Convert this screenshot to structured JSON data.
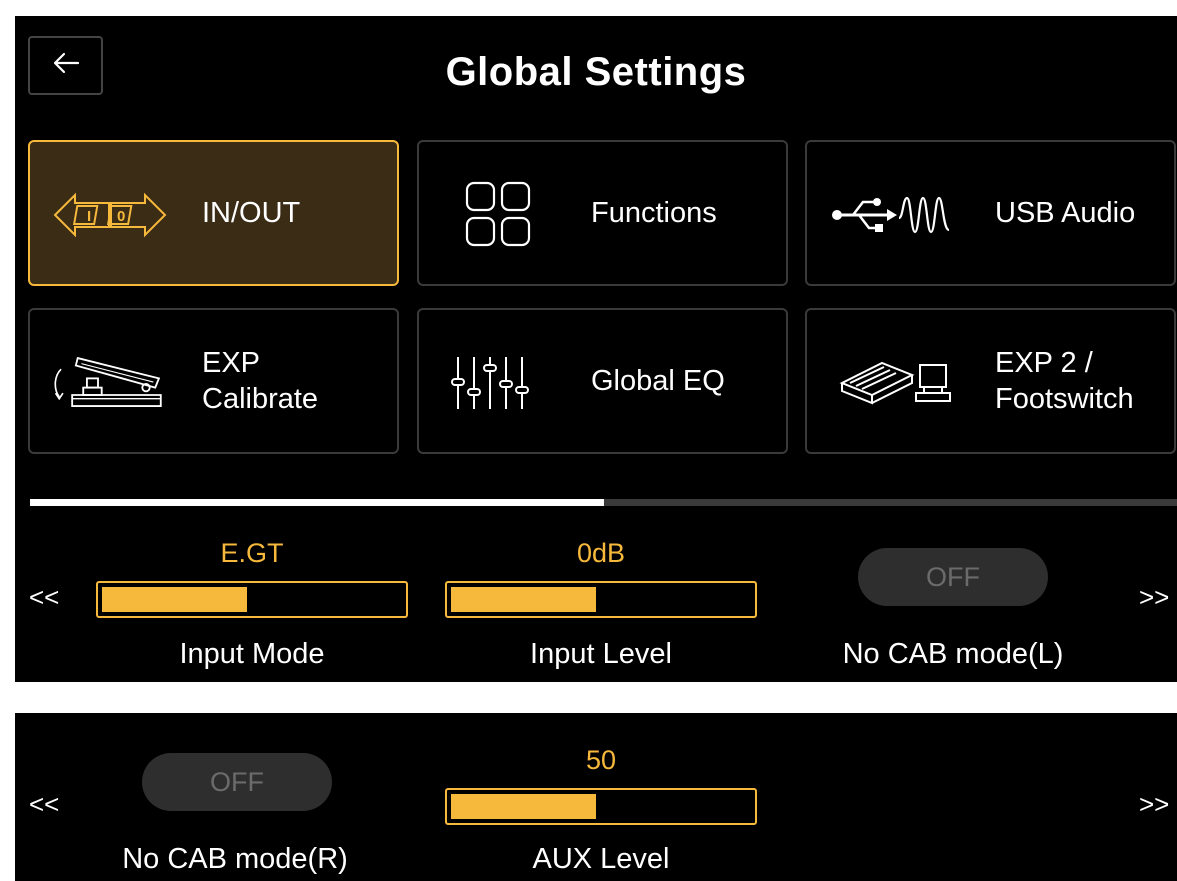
{
  "header": {
    "title": "Global Settings",
    "back_icon": "arrow-left-icon"
  },
  "tiles": [
    {
      "label": "IN/OUT",
      "icon": "in-out-icon",
      "active": true
    },
    {
      "label": "Functions",
      "icon": "grid-icon",
      "active": false
    },
    {
      "label": "USB Audio",
      "icon": "usb-audio-icon",
      "active": false
    },
    {
      "label": "EXP\nCalibrate",
      "icon": "expression-pedal-icon",
      "active": false
    },
    {
      "label": "Global EQ",
      "icon": "equalizer-icon",
      "active": false
    },
    {
      "label": "EXP 2 /\nFootswitch",
      "icon": "footswitch-icon",
      "active": false
    }
  ],
  "page_progress": 0.5,
  "nav": {
    "prev": "<<",
    "next": ">>"
  },
  "controls_page1": {
    "input_mode": {
      "value": "E.GT",
      "label": "Input Mode",
      "level": 0.47
    },
    "input_level": {
      "value": "0dB",
      "label": "Input Level",
      "level": 0.47
    },
    "no_cab_l": {
      "value": "OFF",
      "label": "No CAB mode(L)"
    }
  },
  "controls_page2": {
    "no_cab_r": {
      "value": "OFF",
      "label": "No CAB mode(R)"
    },
    "aux_level": {
      "value": "50",
      "label": "AUX Level",
      "level": 0.47
    }
  },
  "colors": {
    "accent": "#f6b93b",
    "active_tile_bg": "#3b2c16",
    "tile_border": "#3a3a3a",
    "toggle_bg": "#2e2e2e"
  }
}
